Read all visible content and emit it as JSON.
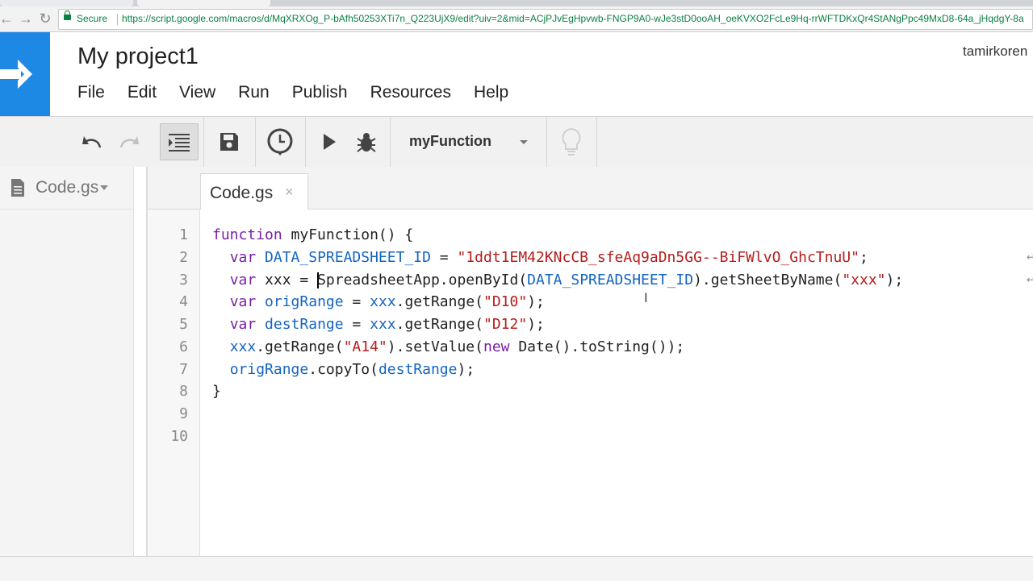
{
  "browser": {
    "security_label": "Secure",
    "url": "https://script.google.com/macros/d/MqXRXOg_P-bAfh50253XTi7n_Q223UjX9/edit?uiv=2&mid=ACjPJvEgHpvwb-FNGP9A0-wJe3stD0ooAH_oeKVXO2FcLe9Hq-rrWFTDKxQr4StANgPpc49MxD8-64a_jHqdgY-8a"
  },
  "header": {
    "project_title": "My project1",
    "user": "tamirkoren"
  },
  "menu": [
    "File",
    "Edit",
    "View",
    "Run",
    "Publish",
    "Resources",
    "Help"
  ],
  "toolbar": {
    "function_select": "myFunction"
  },
  "sidebar": {
    "file_name": "Code.gs"
  },
  "editor": {
    "tab_label": "Code.gs",
    "tab_close": "×",
    "line_numbers": [
      "1",
      "2",
      "3",
      "4",
      "5",
      "6",
      "7",
      "8",
      "9",
      "10"
    ],
    "code": {
      "l1_kw": "function",
      "l1_rest": " myFunction() {",
      "l2_kw": "var",
      "l2_var": "DATA_SPREADSHEET_ID",
      "l2_eq": " = ",
      "l2_str": "\"1ddt1EM42KNcCB_sfeAq9aDn5GG--BiFWlvO_GhcTnuU\"",
      "l2_end": ";",
      "l3_kw": "var",
      "l3_var": "xxx",
      "l3_eq": " = ",
      "l3_mid1": "SpreadsheetApp.openById(",
      "l3_var2": "DATA_SPREADSHEET_ID",
      "l3_mid2": ").getSheetByName(",
      "l3_str": "\"xxx\"",
      "l3_end": ");",
      "l4_kw": "var",
      "l4_var": "origRange",
      "l4_eq": " = ",
      "l4_var2": "xxx",
      "l4_mid": ".getRange(",
      "l4_str": "\"D10\"",
      "l4_end": ");",
      "l5_kw": "var",
      "l5_var": "destRange",
      "l5_eq": " = ",
      "l5_var2": "xxx",
      "l5_mid": ".getRange(",
      "l5_str": "\"D12\"",
      "l5_end": ");",
      "l6_var": "xxx",
      "l6_mid": ".getRange(",
      "l6_str": "\"A14\"",
      "l6_mid2": ").setValue(",
      "l6_kw": "new",
      "l6_end": " Date().toString());",
      "l7_var": "origRange",
      "l7_mid": ".copyTo(",
      "l7_var2": "destRange",
      "l7_end": ");",
      "l8": "}"
    }
  }
}
